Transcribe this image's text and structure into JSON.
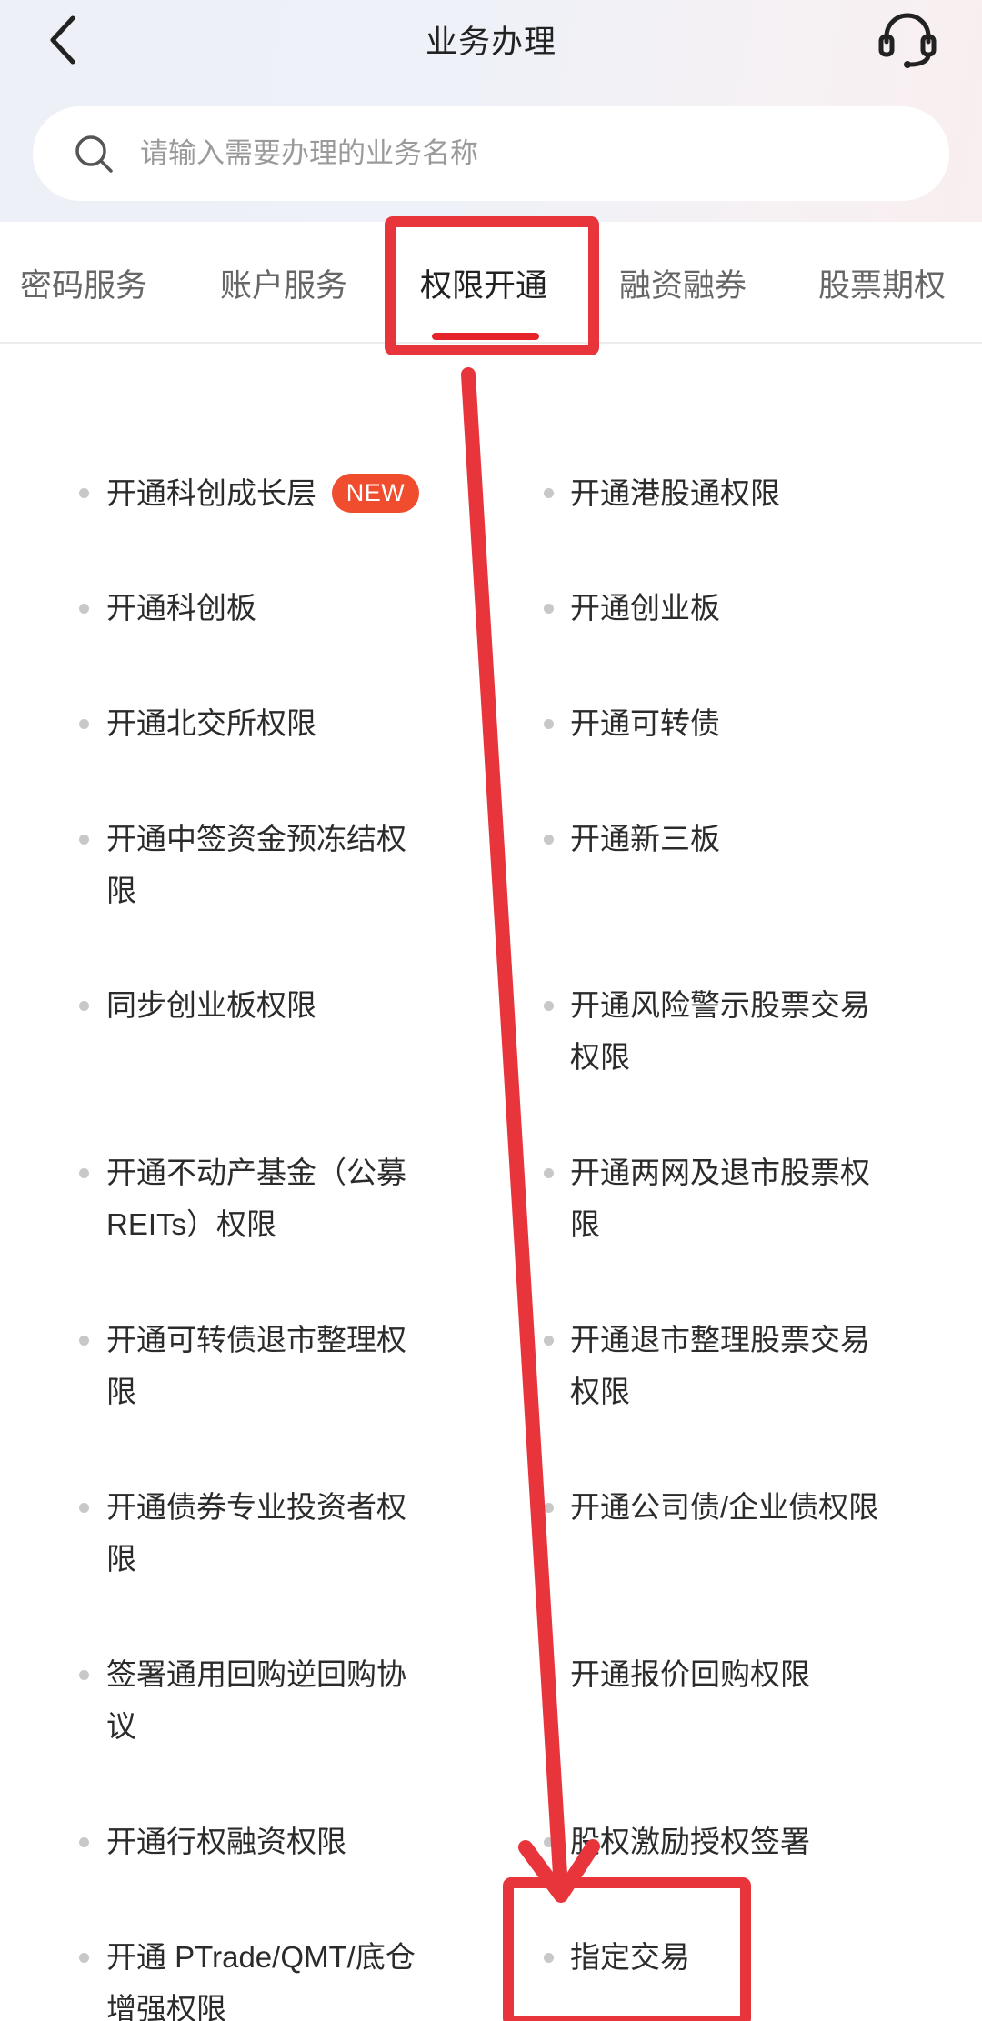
{
  "header": {
    "title": "业务办理",
    "back_icon": "chevron-left-icon",
    "support_icon": "headset-icon"
  },
  "search": {
    "placeholder": "请输入需要办理的业务名称",
    "value": "",
    "icon": "search-icon"
  },
  "tabs": [
    {
      "label": "密码服务",
      "active": false
    },
    {
      "label": "账户服务",
      "active": false
    },
    {
      "label": "权限开通",
      "active": true
    },
    {
      "label": "融资融券",
      "active": false
    },
    {
      "label": "股票期权",
      "active": false
    }
  ],
  "badge": {
    "new_label": "NEW"
  },
  "items": [
    {
      "label": "开通科创成长层",
      "badge": "NEW"
    },
    {
      "label": "开通港股通权限"
    },
    {
      "label": "开通科创板"
    },
    {
      "label": "开通创业板"
    },
    {
      "label": "开通北交所权限"
    },
    {
      "label": "开通可转债"
    },
    {
      "label": "开通中签资金预冻结权限",
      "line1": "开通中签资金预冻结权",
      "line2": "限"
    },
    {
      "label": "开通新三板"
    },
    {
      "label": "同步创业板权限"
    },
    {
      "label": "开通风险警示股票交易权限",
      "line1": "开通风险警示股票交易",
      "line2": "权限"
    },
    {
      "label": "开通不动产基金（公募REITs）权限",
      "line1": "开通不动产基金（公募",
      "line2": "REITs）权限"
    },
    {
      "label": "开通两网及退市股票权限",
      "line1": "开通两网及退市股票权",
      "line2": "限"
    },
    {
      "label": "开通可转债退市整理权限",
      "line1": "开通可转债退市整理权",
      "line2": "限"
    },
    {
      "label": "开通退市整理股票交易权限",
      "line1": "开通退市整理股票交易",
      "line2": "权限"
    },
    {
      "label": "开通债券专业投资者权限",
      "line1": "开通债券专业投资者权",
      "line2": "限"
    },
    {
      "label": "开通公司债/企业债权限"
    },
    {
      "label": "签署通用回购逆回购协议",
      "line1": "签署通用回购逆回购协",
      "line2": "议"
    },
    {
      "label": "开通报价回购权限"
    },
    {
      "label": "开通行权融资权限"
    },
    {
      "label": "股权激励授权签署"
    },
    {
      "label": "开通 PTrade/QMT/底仓增强权限",
      "line1": "开通 PTrade/QMT/底仓",
      "line2": "增强权限"
    },
    {
      "label": "指定交易"
    }
  ],
  "annotation": {
    "color": "#e8353b",
    "description_items": [
      "权限开通",
      "指定交易"
    ]
  }
}
